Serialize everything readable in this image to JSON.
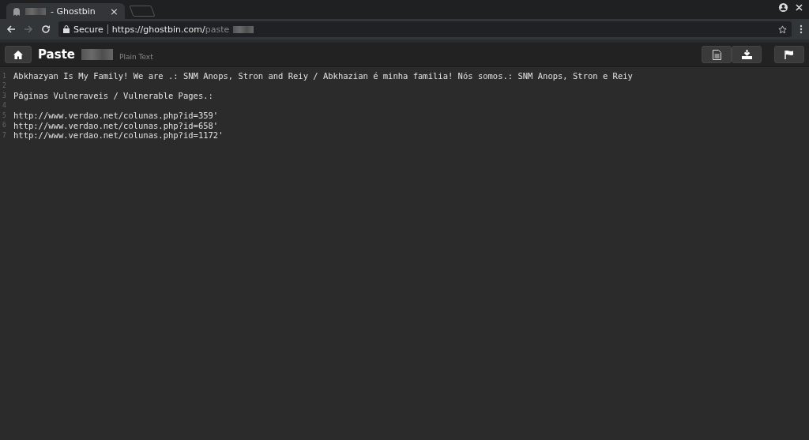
{
  "browser": {
    "tab": {
      "title": "- Ghostbin",
      "close": "×"
    },
    "address": {
      "secure_label": "Secure",
      "url": "https://ghostbin.com/",
      "url_path": "paste"
    }
  },
  "header": {
    "title": "Paste",
    "language": "Plain Text"
  },
  "lines": [
    {
      "number": "1",
      "text": "Abkhazyan Is My Family! We are .: SNM Anops, Stron and Reiy / Abkhazian é minha familia! Nós somos.: SNM Anops, Stron e Reiy"
    },
    {
      "number": "2"
    },
    {
      "number": "3",
      "text": "Páginas Vulneraveis / Vulnerable Pages.:"
    },
    {
      "number": "4"
    },
    {
      "number": "5",
      "text": "http://www.verdao.net/colunas.php?id=359'"
    },
    {
      "number": "6",
      "text": "http://www.verdao.net/colunas.php?id=658'"
    },
    {
      "number": "7",
      "text": "http://www.verdao.net/colunas.php?id=1172'"
    }
  ]
}
